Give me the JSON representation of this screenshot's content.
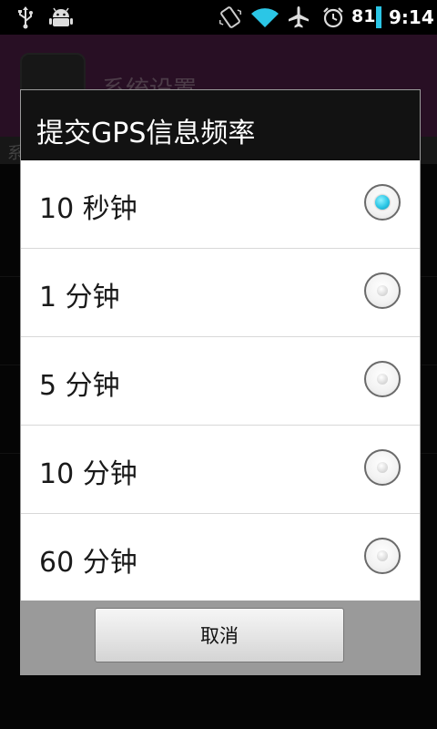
{
  "status_bar": {
    "icons": [
      "usb-icon",
      "android-debug-icon",
      "vibrate-icon",
      "wifi-icon",
      "airplane-icon",
      "alarm-icon",
      "battery-icon"
    ],
    "battery_level": "81",
    "time": "9:14"
  },
  "background_app": {
    "title": "系统设置",
    "subheader": "系统设置"
  },
  "dialog": {
    "title": "提交GPS信息频率",
    "options": [
      {
        "label": "10 秒钟",
        "checked": true
      },
      {
        "label": "1 分钟",
        "checked": false
      },
      {
        "label": "5 分钟",
        "checked": false
      },
      {
        "label": "10 分钟",
        "checked": false
      },
      {
        "label": "60 分钟",
        "checked": false
      }
    ],
    "cancel_label": "取消"
  },
  "colors": {
    "accent_radio": "#2bc6e6",
    "app_header": "#4a1c42",
    "title_bar": "#121212"
  }
}
